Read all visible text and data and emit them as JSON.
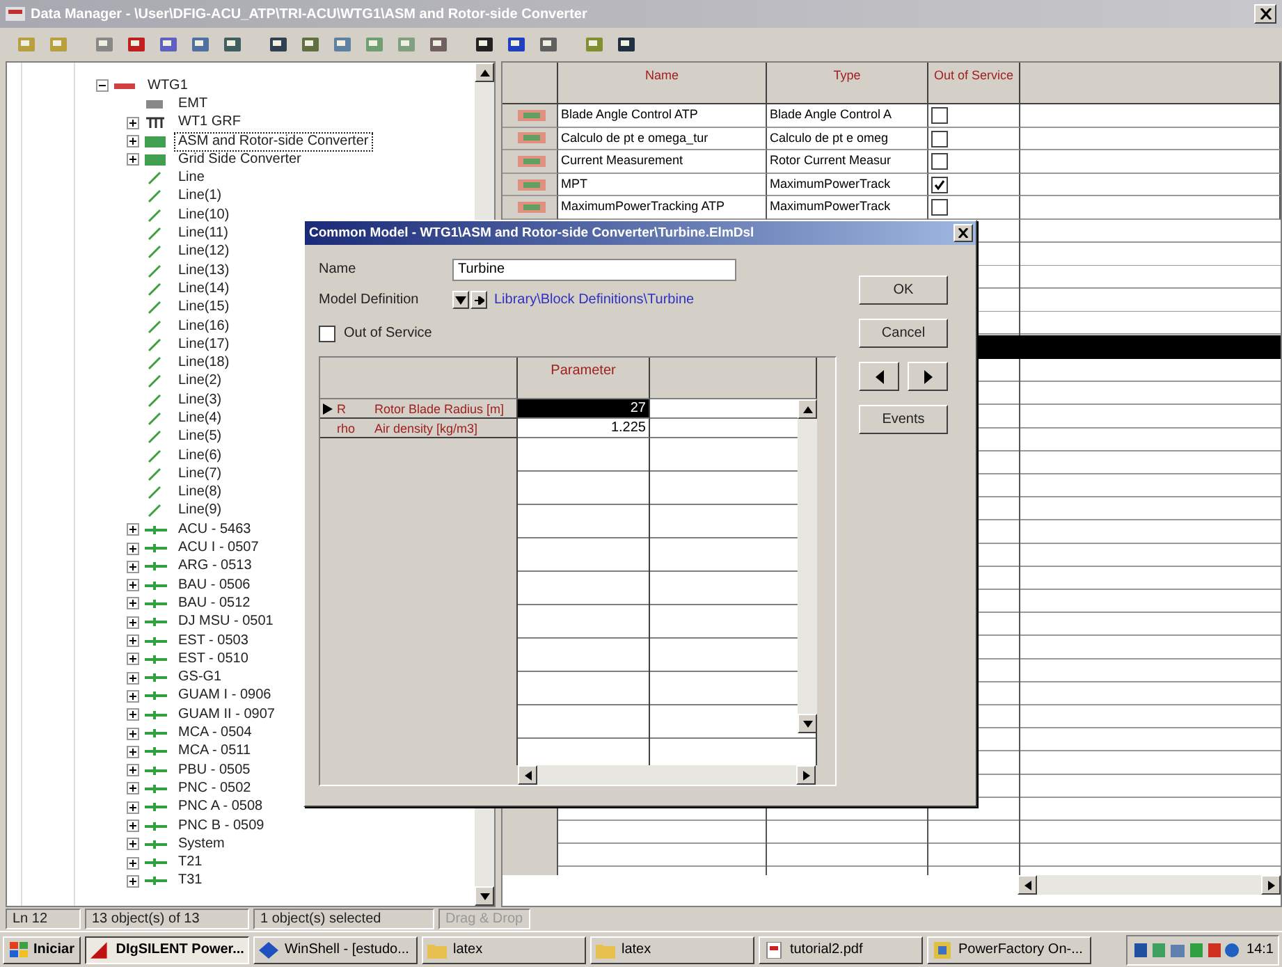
{
  "window": {
    "title": "Data Manager - \\User\\DFIG-ACU_ATP\\TRI-ACU\\WTG1\\ASM and Rotor-side Converter"
  },
  "tree": {
    "items": [
      {
        "label": "WTG1",
        "kind": "grid",
        "expanded": true,
        "focused": false,
        "children": [
          {
            "label": "EMT",
            "kind": "emt",
            "focused": false
          },
          {
            "label": "WT1 GRF",
            "kind": "graphic",
            "expanded": false,
            "focused": false
          },
          {
            "label": "ASM and Rotor-side Converter",
            "kind": "composite",
            "expanded": false,
            "focused": true
          },
          {
            "label": "Grid Side Converter",
            "kind": "composite",
            "expanded": false,
            "focused": false
          },
          {
            "label": "Line",
            "kind": "line",
            "focused": false
          },
          {
            "label": "Line(1)",
            "kind": "line",
            "focused": false
          },
          {
            "label": "Line(10)",
            "kind": "line",
            "focused": false
          },
          {
            "label": "Line(11)",
            "kind": "line",
            "focused": false
          },
          {
            "label": "Line(12)",
            "kind": "line",
            "focused": false
          },
          {
            "label": "Line(13)",
            "kind": "line",
            "focused": false
          },
          {
            "label": "Line(14)",
            "kind": "line",
            "focused": false
          },
          {
            "label": "Line(15)",
            "kind": "line",
            "focused": false
          },
          {
            "label": "Line(16)",
            "kind": "line",
            "focused": false
          },
          {
            "label": "Line(17)",
            "kind": "line",
            "focused": false
          },
          {
            "label": "Line(18)",
            "kind": "line",
            "focused": false
          },
          {
            "label": "Line(2)",
            "kind": "line",
            "focused": false
          },
          {
            "label": "Line(3)",
            "kind": "line",
            "focused": false
          },
          {
            "label": "Line(4)",
            "kind": "line",
            "focused": false
          },
          {
            "label": "Line(5)",
            "kind": "line",
            "focused": false
          },
          {
            "label": "Line(6)",
            "kind": "line",
            "focused": false
          },
          {
            "label": "Line(7)",
            "kind": "line",
            "focused": false
          },
          {
            "label": "Line(8)",
            "kind": "line",
            "focused": false
          },
          {
            "label": "Line(9)",
            "kind": "line",
            "focused": false
          },
          {
            "label": "ACU - 5463",
            "kind": "busbar",
            "expanded": false,
            "focused": false
          },
          {
            "label": "ACU I - 0507",
            "kind": "busbar",
            "expanded": false,
            "focused": false
          },
          {
            "label": "ARG - 0513",
            "kind": "busbar",
            "expanded": false,
            "focused": false
          },
          {
            "label": "BAU - 0506",
            "kind": "busbar",
            "expanded": false,
            "focused": false
          },
          {
            "label": "BAU - 0512",
            "kind": "busbar",
            "expanded": false,
            "focused": false
          },
          {
            "label": "DJ MSU - 0501",
            "kind": "busbar",
            "expanded": false,
            "focused": false
          },
          {
            "label": "EST - 0503",
            "kind": "busbar",
            "expanded": false,
            "focused": false
          },
          {
            "label": "EST - 0510",
            "kind": "busbar",
            "expanded": false,
            "focused": false
          },
          {
            "label": "GS-G1",
            "kind": "busbar",
            "expanded": false,
            "focused": false
          },
          {
            "label": "GUAM I - 0906",
            "kind": "busbar",
            "expanded": false,
            "focused": false
          },
          {
            "label": "GUAM II - 0907",
            "kind": "busbar",
            "expanded": false,
            "focused": false
          },
          {
            "label": "MCA - 0504",
            "kind": "busbar",
            "expanded": false,
            "focused": false
          },
          {
            "label": "MCA - 0511",
            "kind": "busbar",
            "expanded": false,
            "focused": false
          },
          {
            "label": "PBU - 0505",
            "kind": "busbar",
            "expanded": false,
            "focused": false
          },
          {
            "label": "PNC - 0502",
            "kind": "busbar",
            "expanded": false,
            "focused": false
          },
          {
            "label": "PNC A - 0508",
            "kind": "busbar",
            "expanded": false,
            "focused": false
          },
          {
            "label": "PNC B - 0509",
            "kind": "busbar",
            "expanded": false,
            "focused": false
          },
          {
            "label": "System",
            "kind": "busbar",
            "expanded": false,
            "focused": false
          },
          {
            "label": "T21",
            "kind": "busbar",
            "expanded": false,
            "focused": false
          },
          {
            "label": "T31",
            "kind": "busbar",
            "expanded": false,
            "focused": false
          }
        ]
      }
    ]
  },
  "table": {
    "columns": [
      "Name",
      "Type",
      "Out of Service"
    ],
    "rows": [
      {
        "name": "Blade Angle Control ATP",
        "type": "Blade Angle Control A",
        "out_of_service": false,
        "selected": false
      },
      {
        "name": "Calculo de pt e omega_tur",
        "type": "Calculo de pt e omeg",
        "out_of_service": false,
        "selected": false
      },
      {
        "name": "Current Measurement",
        "type": "Rotor Current Measur",
        "out_of_service": false,
        "selected": false
      },
      {
        "name": "MPT",
        "type": "MaximumPowerTrack",
        "out_of_service": true,
        "selected": false
      },
      {
        "name": "MaximumPowerTracking ATP",
        "type": "MaximumPowerTrack",
        "out_of_service": false,
        "selected": false
      }
    ],
    "hidden_rows": [
      {
        "selected": false
      },
      {
        "selected": false
      },
      {
        "selected": false
      },
      {
        "selected": false
      },
      {
        "selected": false
      },
      {
        "selected": true
      }
    ]
  },
  "dialog": {
    "title": "Common Model - WTG1\\ASM and Rotor-side Converter\\Turbine.ElmDsl",
    "name_label": "Name",
    "name_value": "Turbine",
    "model_label": "Model Definition",
    "model_link": "Library\\Block Definitions\\Turbine",
    "out_of_service": {
      "label": "Out of Service",
      "checked": false
    },
    "grid": {
      "column": "Parameter",
      "rows": [
        {
          "symbol": "R",
          "description": "Rotor Blade Radius [m]",
          "value": "27",
          "selected": true
        },
        {
          "symbol": "rho",
          "description": "Air density [kg/m3]",
          "value": "1.225",
          "selected": false
        }
      ]
    },
    "buttons": [
      "OK",
      "Cancel"
    ],
    "events_button": "Events"
  },
  "status_bar": [
    {
      "text": "Ln 12",
      "disabled": false
    },
    {
      "text": "13 object(s) of 13",
      "disabled": false
    },
    {
      "text": "1 object(s) selected",
      "disabled": false
    },
    {
      "text": "Drag & Drop",
      "disabled": true
    }
  ],
  "taskbar": {
    "start": "Iniciar",
    "tasks": [
      {
        "label": "DIgSILENT Power...",
        "kind": "app",
        "active": true
      },
      {
        "label": "WinShell - [estudo...",
        "kind": "editor",
        "active": false
      },
      {
        "label": "latex",
        "kind": "folder",
        "active": false
      },
      {
        "label": "latex",
        "kind": "folder",
        "active": false
      },
      {
        "label": "tutorial2.pdf",
        "kind": "pdf",
        "active": false
      },
      {
        "label": "PowerFactory On-...",
        "kind": "help",
        "active": false
      }
    ],
    "clock": "14:1"
  }
}
